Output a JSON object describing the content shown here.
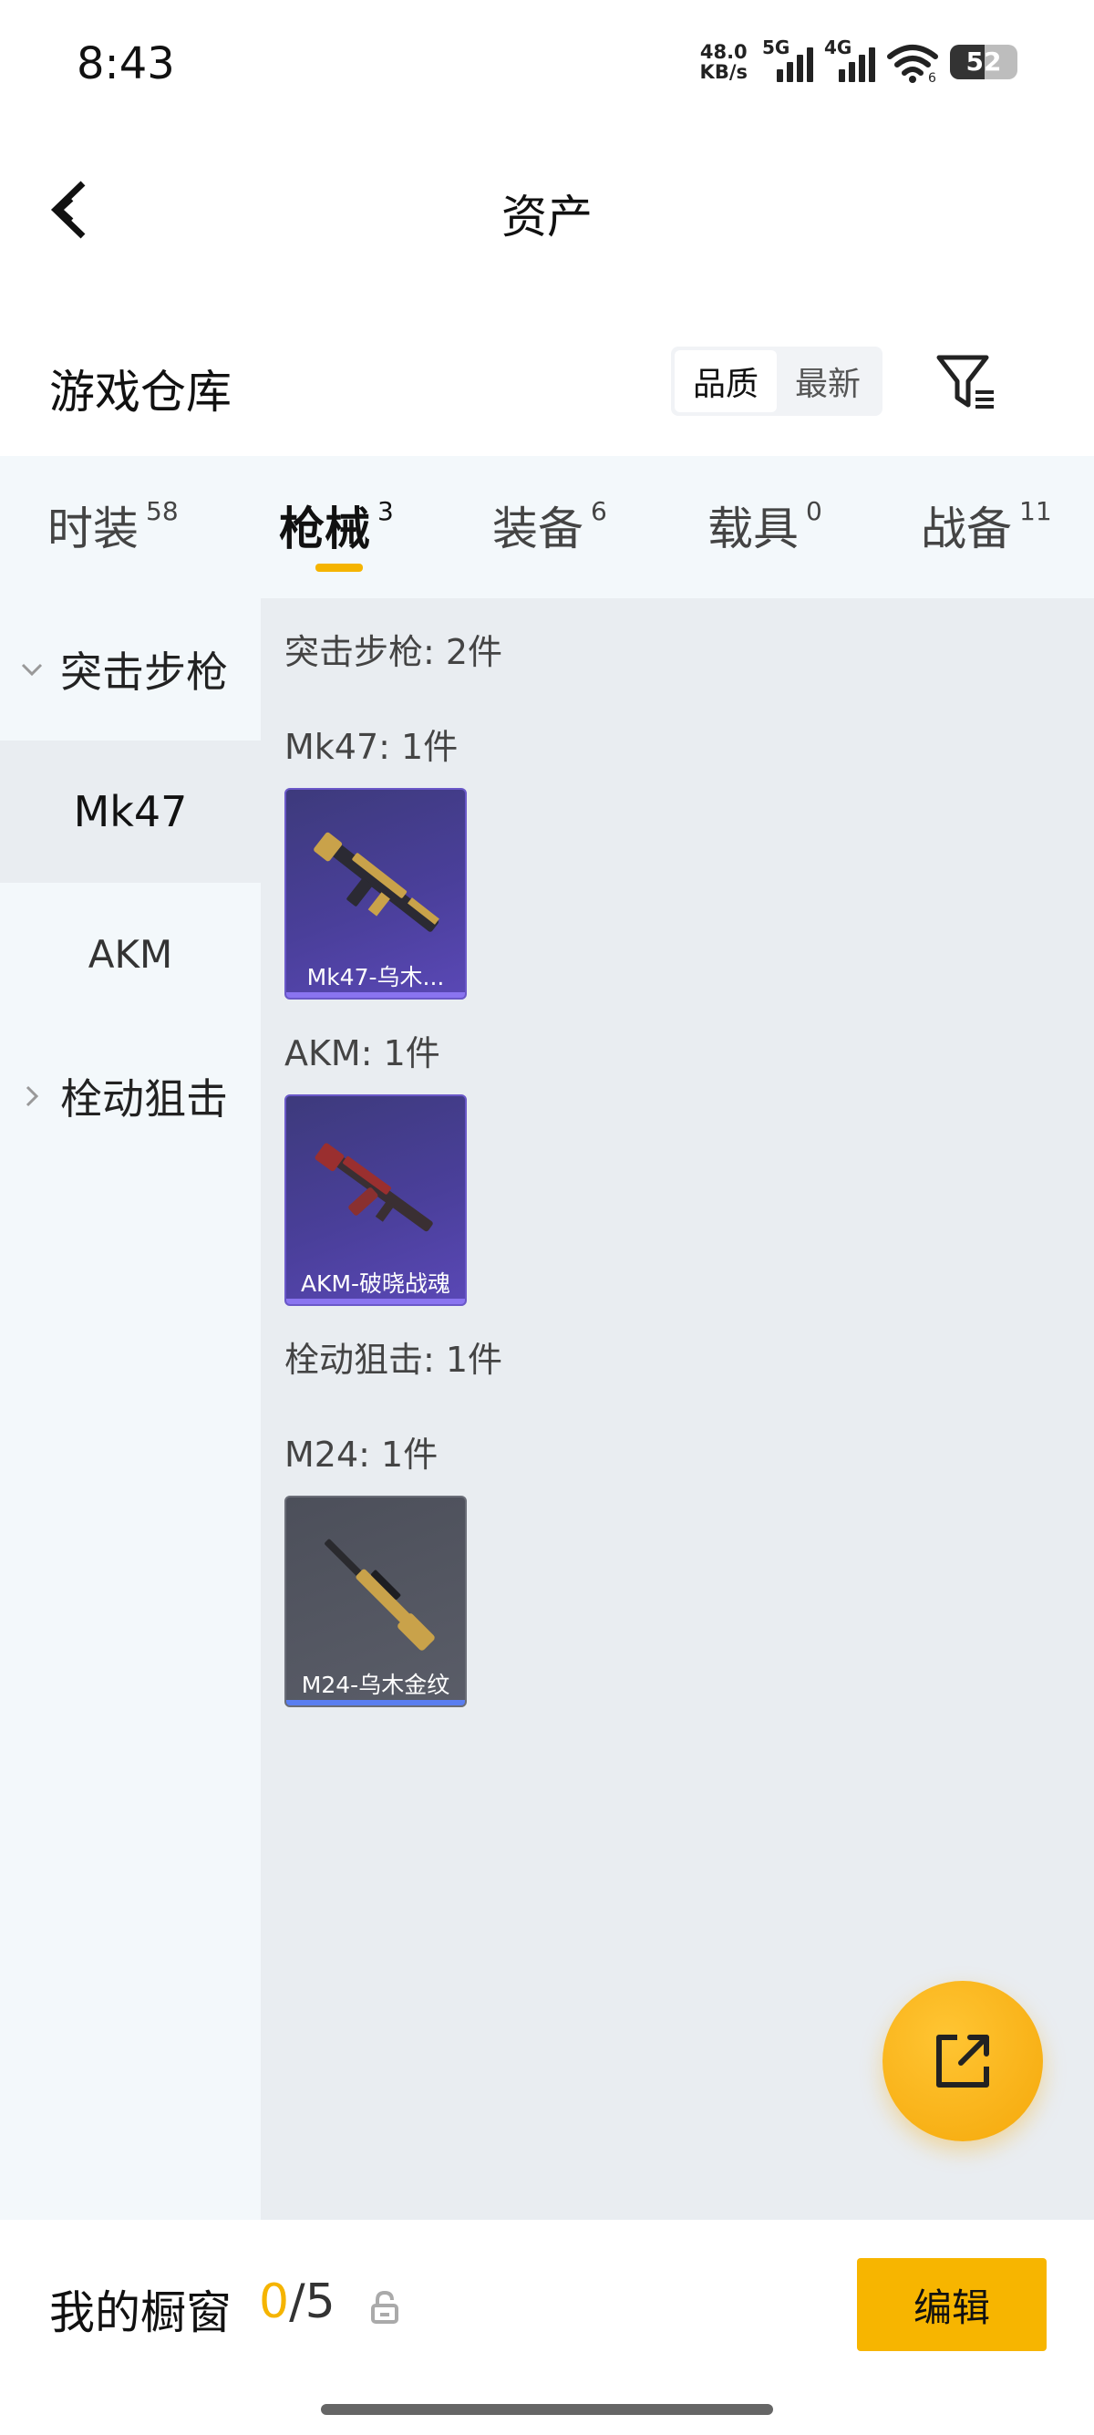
{
  "status_bar": {
    "time": "8:43",
    "net_speed_value": "48.0",
    "net_speed_unit": "KB/s",
    "sim1_label": "5G",
    "sim2_label": "4G",
    "wifi_badge": "6",
    "battery": "52"
  },
  "nav": {
    "title": "资产",
    "back_icon": "chevron-left-icon"
  },
  "warehouse": {
    "title": "游戏仓库",
    "sort_options": [
      "品质",
      "最新"
    ],
    "sort_selected": "品质",
    "filter_icon": "filter-icon"
  },
  "tabs": [
    {
      "label": "时装",
      "count": "58"
    },
    {
      "label": "枪械",
      "count": "3"
    },
    {
      "label": "装备",
      "count": "6"
    },
    {
      "label": "载具",
      "count": "0"
    },
    {
      "label": "战备",
      "count": "11"
    }
  ],
  "active_tab": "枪械",
  "sidebar": {
    "groups": [
      {
        "label": "突击步枪",
        "expanded": true,
        "icon": "chevron-down-icon"
      },
      {
        "label": "栓动狙击",
        "expanded": false,
        "icon": "chevron-right-icon"
      }
    ],
    "items": [
      {
        "label": "Mk47"
      },
      {
        "label": "AKM"
      }
    ],
    "selected_item": "Mk47"
  },
  "content": {
    "sections": [
      {
        "label": "突击步枪: 2件"
      },
      {
        "label": "Mk47: 1件"
      },
      {
        "label": "AKM: 1件"
      },
      {
        "label": "栓动狙击: 1件"
      },
      {
        "label": "M24: 1件"
      }
    ],
    "cards": [
      {
        "name": "Mk47-乌木...",
        "rarity": "purple",
        "icon": "rifle-icon"
      },
      {
        "name": "AKM-破晓战魂",
        "rarity": "purple",
        "icon": "rifle-icon"
      },
      {
        "name": "M24-乌木金纹",
        "rarity": "gray",
        "icon": "sniper-rifle-icon"
      }
    ]
  },
  "fab": {
    "icon": "share-icon"
  },
  "bottom_bar": {
    "title": "我的橱窗",
    "count_current": "0",
    "count_total": "/5",
    "lock_icon": "lock-icon",
    "edit_label": "编辑"
  },
  "colors": {
    "accent": "#f5b400",
    "purple_rarity": "#5a48b6",
    "gray_rarity": "#5a5d68"
  }
}
